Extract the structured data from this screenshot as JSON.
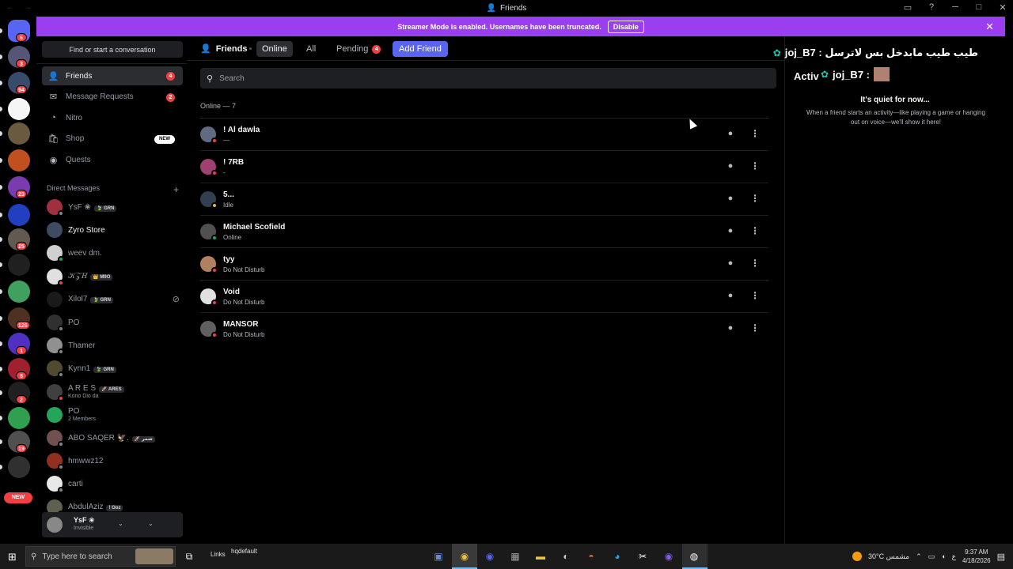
{
  "window": {
    "title": "Friends",
    "nav_back": "←",
    "nav_forward": "→",
    "controls": [
      "▭",
      "?",
      "─",
      "□",
      "✕"
    ]
  },
  "rail": {
    "servers": [
      {
        "color": "#5865f2",
        "badge": "6",
        "icon": "discord-home-icon"
      },
      {
        "color": "#555577",
        "badge": "3"
      },
      {
        "color": "#3a4a6a",
        "badge": "94"
      },
      {
        "color": "#f5f5f5",
        "badge": ""
      },
      {
        "color": "#6a5a40",
        "badge": ""
      },
      {
        "color": "#c05020",
        "badge": ""
      },
      {
        "color": "#7a3ab0",
        "badge": "23"
      },
      {
        "color": "#2040c0",
        "badge": ""
      },
      {
        "color": "#605a50",
        "badge": "25"
      },
      {
        "color": "#202020",
        "badge": ""
      },
      {
        "color": "#40a060",
        "badge": ""
      },
      {
        "color": "#503020",
        "badge": "126"
      },
      {
        "color": "#5030c0",
        "badge": "1"
      },
      {
        "color": "#a02030",
        "badge": "8"
      },
      {
        "color": "#202020",
        "badge": "2"
      },
      {
        "color": "#30a050",
        "badge": ""
      },
      {
        "color": "#505050",
        "badge": "19"
      },
      {
        "color": "#303030",
        "badge": ""
      }
    ],
    "new_label": "NEW"
  },
  "banner": {
    "text": "Streamer Mode is enabled. Usernames have been truncated.",
    "disable_label": "Disable",
    "close": "✕"
  },
  "sidebar": {
    "find_placeholder": "Find or start a conversation",
    "nav": [
      {
        "label": "Friends",
        "icon": "👤",
        "badge": "4"
      },
      {
        "label": "Message Requests",
        "icon": "✉",
        "badge": "2"
      },
      {
        "label": "Nitro",
        "icon": "◔",
        "badge": ""
      },
      {
        "label": "Shop",
        "icon": "🛍",
        "badge": ""
      },
      {
        "label": "Quests",
        "icon": "◉",
        "badge": ""
      }
    ],
    "shop_badge": "NEW",
    "dm_header": "Direct Messages",
    "dm_add": "+",
    "dms": [
      {
        "name": "YsF ❀",
        "tag": "🍃 GRN",
        "sub": "",
        "color": "#a03040",
        "status": "#80848e",
        "bright": false
      },
      {
        "name": "Zyro Store",
        "tag": "",
        "sub": "",
        "color": "#404a60",
        "status": "",
        "bright": true
      },
      {
        "name": "weev dm.",
        "tag": "",
        "sub": "",
        "color": "#d0d0d0",
        "status": "#23a55a",
        "bright": false
      },
      {
        "name": "𝒦𝒵𝐻",
        "tag": "👑 M9O",
        "sub": "",
        "color": "#e0e0e0",
        "status": "#f23f43",
        "bright": false
      },
      {
        "name": "Xilol7",
        "tag": "🍃 GRN",
        "sub": "",
        "color": "#1a1a1a",
        "status": "",
        "bright": false
      },
      {
        "name": "PO",
        "tag": "",
        "sub": "",
        "color": "#303030",
        "status": "#80848e",
        "bright": false
      },
      {
        "name": "Thamer",
        "tag": "",
        "sub": "",
        "color": "#909090",
        "status": "#80848e",
        "bright": false
      },
      {
        "name": "Kynn1",
        "tag": "🍃 GRN",
        "sub": "",
        "color": "#504a30",
        "status": "#80848e",
        "bright": false
      },
      {
        "name": "A R E S",
        "tag": "🚀 ARES",
        "sub": "Kono Dio da",
        "color": "#404040",
        "status": "#f23f43",
        "bright": false
      },
      {
        "name": "PO",
        "tag": "",
        "sub": "2 Members",
        "color": "#23a55a",
        "status": "",
        "bright": false
      },
      {
        "name": "ABO SAQER 🦅.",
        "tag": "🚀 شمر",
        "sub": "",
        "color": "#705050",
        "status": "#80848e",
        "bright": false
      },
      {
        "name": "hmwwz12",
        "tag": "",
        "sub": "",
        "color": "#903020",
        "status": "#80848e",
        "bright": false
      },
      {
        "name": "carti",
        "tag": "",
        "sub": "",
        "color": "#e8e8e8",
        "status": "#80848e",
        "bright": false
      },
      {
        "name": "AbdulAziz",
        "tag": "! Ooz",
        "sub": "",
        "color": "#606050",
        "status": "#80848e",
        "bright": false
      }
    ],
    "user": {
      "name": "YsF ❀",
      "status": "Invisible",
      "ctl1": "⌄",
      "ctl2": "⌄"
    }
  },
  "main": {
    "friends_label": "Friends",
    "tabs": {
      "online": "Online",
      "all": "All",
      "pending": "Pending",
      "pending_badge": "4"
    },
    "add_friend": "Add Friend",
    "search_placeholder": "Search",
    "online_count": "Online — 7",
    "friends": [
      {
        "name": "! Al dawla",
        "status": "—",
        "color": "#606a80",
        "dot": "#f23f43"
      },
      {
        "name": "! 7RB",
        "status": "-",
        "color": "#a04070",
        "dot": "#f23f43"
      },
      {
        "name": "5...",
        "status": "Idle",
        "color": "#304050",
        "dot": "#f0b232"
      },
      {
        "name": "Michael Scofield",
        "status": "Online",
        "color": "#505050",
        "dot": "#23a55a"
      },
      {
        "name": "tyy",
        "status": "Do Not Disturb",
        "color": "#b08060",
        "dot": "#f23f43"
      },
      {
        "name": "Void",
        "status": "Do Not Disturb",
        "color": "#e0e0e0",
        "dot": "#f23f43"
      },
      {
        "name": "MANSOR",
        "status": "Do Not Disturb",
        "color": "#606060",
        "dot": "#f23f43"
      }
    ]
  },
  "activity": {
    "head": "Activ",
    "quiet": "It's quiet for now...",
    "desc": "When a friend starts an activity—like playing a game or hanging out on voice—we'll show it here!",
    "overlay1": "joj_B7 : طيب طيب مابدخل بس لاترسل",
    "overlay2": "joj_B7 :"
  },
  "taskbar": {
    "search_placeholder": "Type here to search",
    "links": "Links",
    "hq": "hqdefault",
    "weather": "30°C مشمس",
    "time": "9:37 AM",
    "date": "4/18/2026",
    "lang": "ع"
  }
}
